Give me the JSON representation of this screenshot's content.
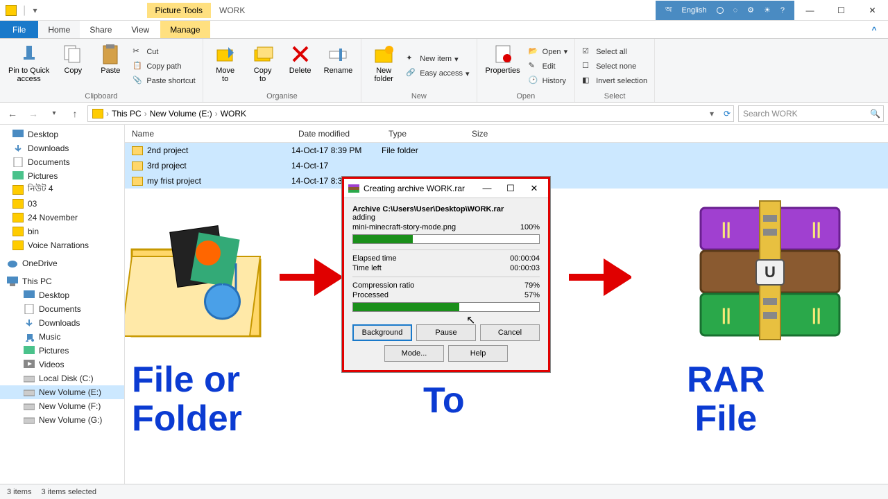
{
  "titlebar": {
    "tool_tab": "Picture Tools",
    "window_title": "WORK",
    "lang_label": "English"
  },
  "tabs": {
    "file": "File",
    "home": "Home",
    "share": "Share",
    "view": "View",
    "manage": "Manage"
  },
  "ribbon": {
    "pin": "Pin to Quick\naccess",
    "copy": "Copy",
    "paste": "Paste",
    "cut": "Cut",
    "copy_path": "Copy path",
    "paste_shortcut": "Paste shortcut",
    "clipboard": "Clipboard",
    "move_to": "Move\nto",
    "copy_to": "Copy\nto",
    "delete": "Delete",
    "rename": "Rename",
    "organise": "Organise",
    "new_folder": "New\nfolder",
    "new_item": "New item",
    "easy_access": "Easy access",
    "new": "New",
    "properties": "Properties",
    "open": "Open",
    "edit": "Edit",
    "history": "History",
    "open_group": "Open",
    "select_all": "Select all",
    "select_none": "Select none",
    "invert": "Invert selection",
    "select": "Select"
  },
  "breadcrumb": {
    "this_pc": "This PC",
    "volume": "New Volume (E:)",
    "folder": "WORK",
    "search_placeholder": "Search WORK"
  },
  "columns": {
    "name": "Name",
    "modified": "Date modified",
    "type": "Type",
    "size": "Size"
  },
  "files": [
    {
      "name": "2nd project",
      "modified": "14-Oct-17 8:39 PM",
      "type": "File folder"
    },
    {
      "name": "3rd project",
      "modified": "14-Oct-17",
      "type": ""
    },
    {
      "name": "my frist project",
      "modified": "14-Oct-17 8:3",
      "type": ""
    }
  ],
  "tree": {
    "desktop": "Desktop",
    "downloads": "Downloads",
    "documents": "Documents",
    "pictures": "Pictures",
    "custom1": "নিউট 4",
    "custom2": "03",
    "custom3": "24 November",
    "custom4": "bin",
    "custom5": "Voice Narrations",
    "onedrive": "OneDrive",
    "this_pc": "This PC",
    "pc_desktop": "Desktop",
    "pc_documents": "Documents",
    "pc_downloads": "Downloads",
    "pc_music": "Music",
    "pc_pictures": "Pictures",
    "pc_videos": "Videos",
    "local_c": "Local Disk (C:)",
    "vol_e": "New Volume (E:)",
    "vol_f": "New Volume (F:)",
    "vol_g": "New Volume (G:)"
  },
  "dialog": {
    "title": "Creating archive WORK.rar",
    "archive_path": "Archive C:\\Users\\User\\Desktop\\WORK.rar",
    "adding": "adding",
    "current_file": "mini-minecraft-story-mode.png",
    "file_pct": "100%",
    "elapsed_label": "Elapsed time",
    "elapsed_val": "00:00:04",
    "left_label": "Time left",
    "left_val": "00:00:03",
    "ratio_label": "Compression ratio",
    "ratio_val": "79%",
    "processed_label": "Processed",
    "processed_val": "57%",
    "background": "Background",
    "pause": "Pause",
    "cancel": "Cancel",
    "mode": "Mode...",
    "help": "Help"
  },
  "overlay": {
    "left": "File or\nFolder",
    "mid": "To",
    "right": "RAR\nFile"
  },
  "status": {
    "items": "3 items",
    "selected": "3 items selected"
  }
}
